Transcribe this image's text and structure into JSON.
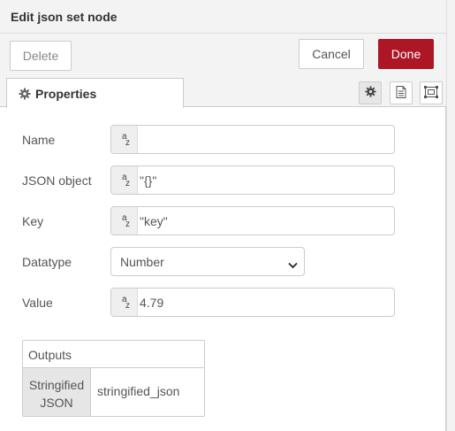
{
  "dialog": {
    "title": "Edit json set node"
  },
  "toolbar": {
    "delete_label": "Delete",
    "cancel_label": "Cancel",
    "done_label": "Done"
  },
  "tabs": {
    "properties_label": "Properties"
  },
  "tab_icons": [
    "gear-icon",
    "description-icon",
    "appearance-icon"
  ],
  "form": {
    "name": {
      "label": "Name",
      "type_icon": "a z",
      "value": ""
    },
    "json_object": {
      "label": "JSON object",
      "type_icon": "a z",
      "value": "\"{}\""
    },
    "key": {
      "label": "Key",
      "type_icon": "a z",
      "value": "\"key\""
    },
    "datatype": {
      "label": "Datatype",
      "selected": "Number"
    },
    "value": {
      "label": "Value",
      "type_icon": "a z",
      "value": "4.79"
    }
  },
  "outputs": {
    "header": "Outputs",
    "key_line1": "Stringified",
    "key_line2": "JSON",
    "value": "stringified_json"
  },
  "colors": {
    "done_button": "#ad1625",
    "panel_bg": "#f3f3f3"
  }
}
